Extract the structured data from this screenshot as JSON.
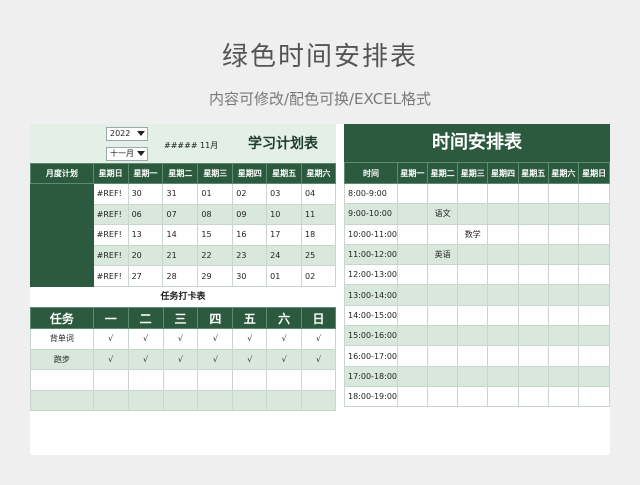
{
  "page": {
    "title": "绿色时间安排表",
    "subtitle": "内容可修改/配色可换/EXCEL格式"
  },
  "plan": {
    "year_select": "2022",
    "month_select": "十一月",
    "date_display": "##### 11月",
    "title": "学习计划表",
    "row_label": "月度计划",
    "day_headers": [
      "星期日",
      "星期一",
      "星期二",
      "星期三",
      "星期四",
      "星期五",
      "星期六"
    ],
    "weeks": [
      [
        "#REF!",
        "30",
        "31",
        "01",
        "02",
        "03",
        "04"
      ],
      [
        "#REF!",
        "06",
        "07",
        "08",
        "09",
        "10",
        "11"
      ],
      [
        "#REF!",
        "13",
        "14",
        "15",
        "16",
        "17",
        "18"
      ],
      [
        "#REF!",
        "20",
        "21",
        "22",
        "23",
        "24",
        "25"
      ],
      [
        "#REF!",
        "27",
        "28",
        "29",
        "30",
        "01",
        "02"
      ]
    ]
  },
  "tasks": {
    "title": "任务打卡表",
    "headers": [
      "任务",
      "一",
      "二",
      "三",
      "四",
      "五",
      "六",
      "日"
    ],
    "rows": [
      [
        "背单词",
        "√",
        "√",
        "√",
        "√",
        "√",
        "√",
        "√"
      ],
      [
        "跑步",
        "√",
        "√",
        "√",
        "√",
        "√",
        "√",
        "√"
      ],
      [
        "",
        "",
        "",
        "",
        "",
        "",
        "",
        ""
      ],
      [
        "",
        "",
        "",
        "",
        "",
        "",
        "",
        ""
      ]
    ]
  },
  "schedule": {
    "title": "时间安排表",
    "headers": [
      "时间",
      "星期一",
      "星期二",
      "星期三",
      "星期四",
      "星期五",
      "星期六",
      "星期日"
    ],
    "rows": [
      [
        "8:00-9:00",
        "",
        "",
        "",
        "",
        "",
        "",
        ""
      ],
      [
        "9:00-10:00",
        "",
        "语文",
        "",
        "",
        "",
        "",
        ""
      ],
      [
        "10:00-11:00",
        "",
        "",
        "数学",
        "",
        "",
        "",
        ""
      ],
      [
        "11:00-12:00",
        "",
        "英语",
        "",
        "",
        "",
        "",
        ""
      ],
      [
        "12:00-13:00",
        "",
        "",
        "",
        "",
        "",
        "",
        ""
      ],
      [
        "13:00-14:00",
        "",
        "",
        "",
        "",
        "",
        "",
        ""
      ],
      [
        "14:00-15:00",
        "",
        "",
        "",
        "",
        "",
        "",
        ""
      ],
      [
        "15:00-16:00",
        "",
        "",
        "",
        "",
        "",
        "",
        ""
      ],
      [
        "16:00-17:00",
        "",
        "",
        "",
        "",
        "",
        "",
        ""
      ],
      [
        "17:00-18:00",
        "",
        "",
        "",
        "",
        "",
        "",
        ""
      ],
      [
        "18:00-19:00",
        "",
        "",
        "",
        "",
        "",
        "",
        ""
      ]
    ]
  },
  "colors": {
    "dark_green": "#2b5a3e",
    "light_green": "#d8e8dd",
    "header_tint": "#e4efe8",
    "background": "#efefef"
  }
}
